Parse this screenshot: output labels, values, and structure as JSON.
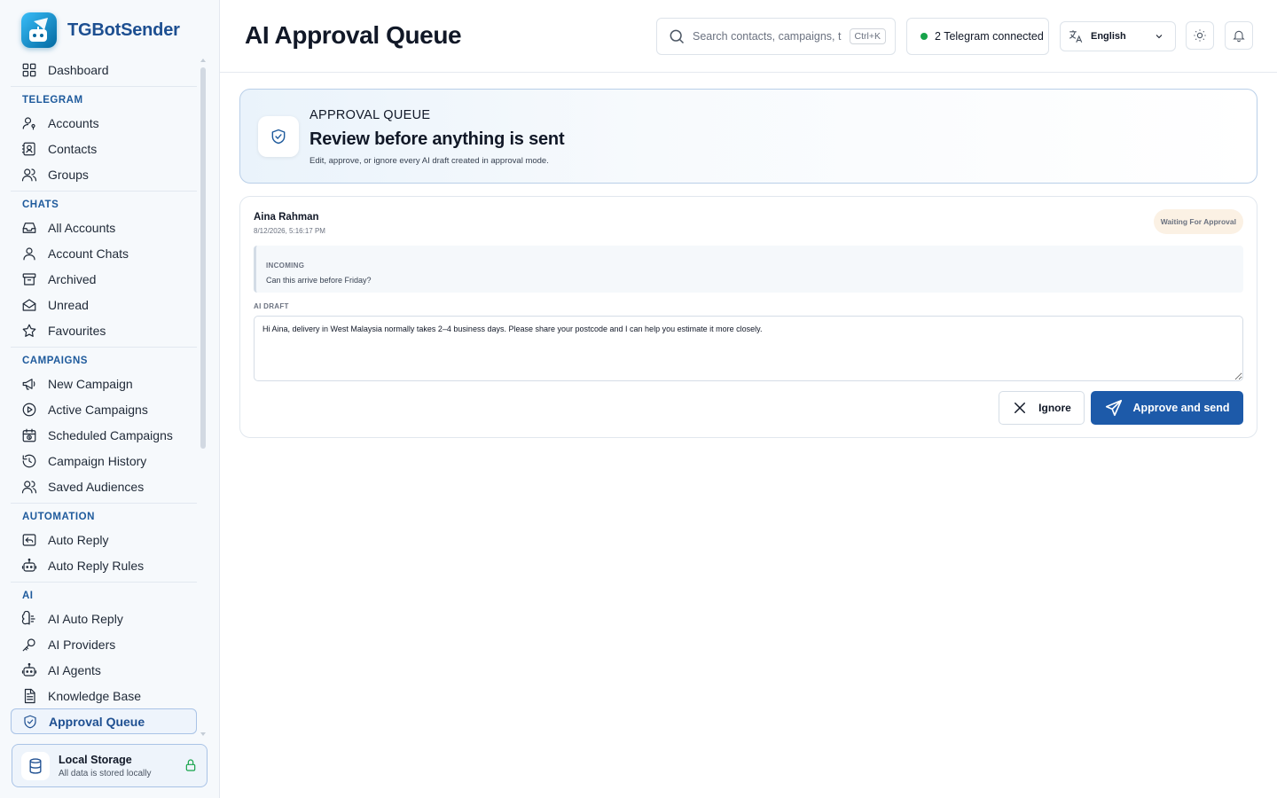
{
  "app": {
    "name": "TGBotSender"
  },
  "sidebar": {
    "top_item": {
      "label": "Dashboard",
      "icon": "grid-icon"
    },
    "sections": [
      {
        "title": "TELEGRAM",
        "items": [
          {
            "label": "Accounts",
            "icon": "user-key-icon"
          },
          {
            "label": "Contacts",
            "icon": "contact-book-icon"
          },
          {
            "label": "Groups",
            "icon": "users-icon"
          }
        ]
      },
      {
        "title": "CHATS",
        "items": [
          {
            "label": "All Accounts",
            "icon": "inbox-icon"
          },
          {
            "label": "Account Chats",
            "icon": "user-icon"
          },
          {
            "label": "Archived",
            "icon": "archive-icon"
          },
          {
            "label": "Unread",
            "icon": "mail-open-icon"
          },
          {
            "label": "Favourites",
            "icon": "star-icon"
          }
        ]
      },
      {
        "title": "CAMPAIGNS",
        "items": [
          {
            "label": "New Campaign",
            "icon": "megaphone-icon"
          },
          {
            "label": "Active Campaigns",
            "icon": "play-circle-icon"
          },
          {
            "label": "Scheduled Campaigns",
            "icon": "calendar-clock-icon"
          },
          {
            "label": "Campaign History",
            "icon": "history-icon"
          },
          {
            "label": "Saved Audiences",
            "icon": "users-icon"
          }
        ]
      },
      {
        "title": "AUTOMATION",
        "items": [
          {
            "label": "Auto Reply",
            "icon": "reply-icon"
          },
          {
            "label": "Auto Reply Rules",
            "icon": "bot-icon"
          }
        ]
      },
      {
        "title": "AI",
        "items": [
          {
            "label": "AI Auto Reply",
            "icon": "brain-icon"
          },
          {
            "label": "AI Providers",
            "icon": "key-icon"
          },
          {
            "label": "AI Agents",
            "icon": "bot-icon"
          },
          {
            "label": "Knowledge Base",
            "icon": "document-icon"
          },
          {
            "label": "Approval Queue",
            "icon": "shield-check-icon",
            "active": true
          }
        ]
      }
    ],
    "storage": {
      "title": "Local Storage",
      "subtitle": "All data is stored locally"
    }
  },
  "header": {
    "title": "AI Approval Queue",
    "search": {
      "placeholder": "Search contacts, campaigns, t...",
      "value": "",
      "shortcut": "Ctrl+K"
    },
    "connection": {
      "label": "2 Telegram connected",
      "status_color": "#16a34a"
    },
    "language": {
      "selected": "English"
    }
  },
  "hero": {
    "eyebrow": "APPROVAL QUEUE",
    "title": "Review before anything is sent",
    "subtitle": "Edit, approve, or ignore every AI draft created in approval mode."
  },
  "queue": [
    {
      "name": "Aina Rahman",
      "timestamp": "8/12/2026, 5:16:17 PM",
      "status": "Waiting For Approval",
      "incoming_label": "INCOMING",
      "incoming_text": "Can this arrive before Friday?",
      "draft_label": "AI DRAFT",
      "draft_text": "Hi Aina, delivery in West Malaysia normally takes 2–4 business days. Please share your postcode and I can help you estimate it more closely.",
      "ignore_label": "Ignore",
      "approve_label": "Approve and send"
    }
  ],
  "colors": {
    "accent": "#1d5aa9",
    "brand": "#1d4f91",
    "section_title": "#1e5a9c",
    "badge_bg": "#fbf1e4"
  }
}
